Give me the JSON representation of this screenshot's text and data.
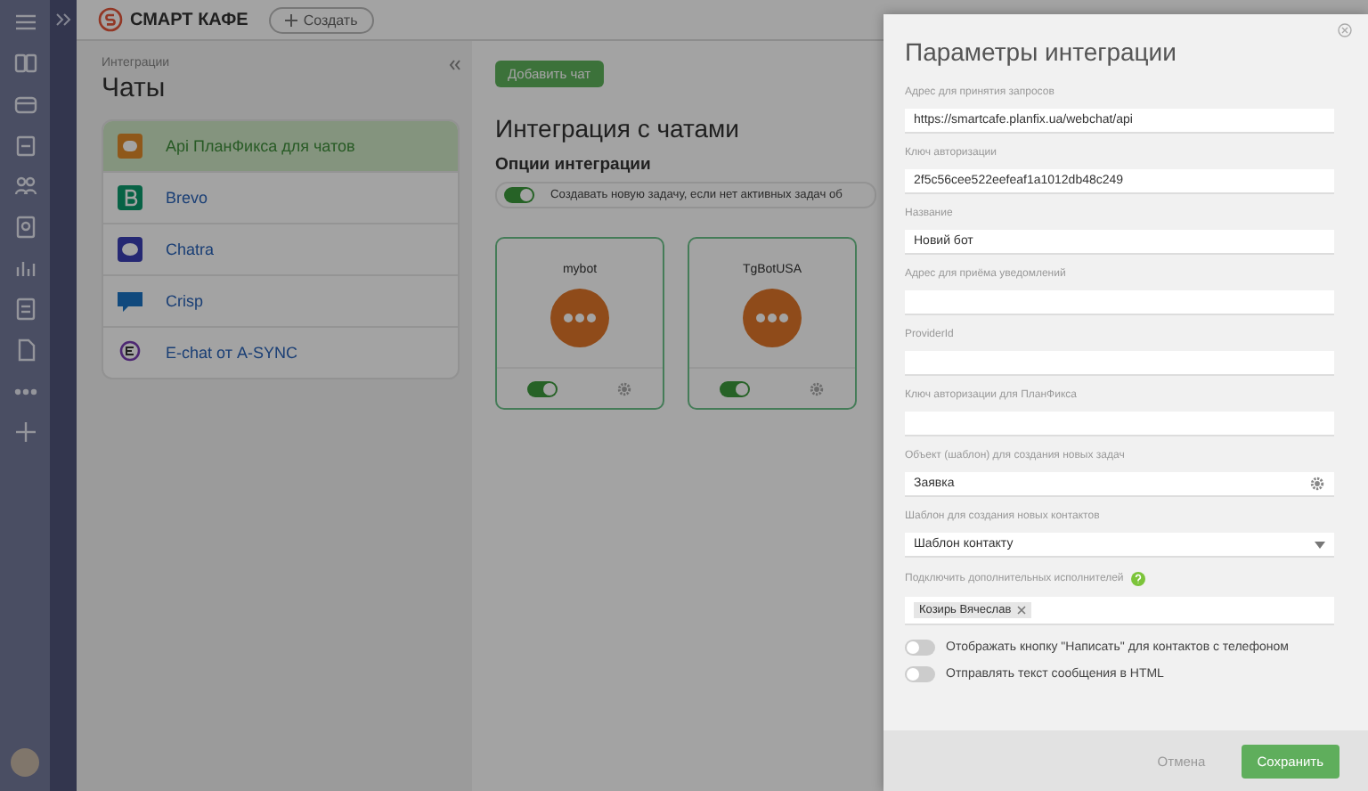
{
  "topbar": {
    "logo": "СМАРТ КАФЕ",
    "create_button": "Создать"
  },
  "left_panel": {
    "breadcrumb": "Интеграции",
    "title": "Чаты",
    "items": [
      {
        "label": "Api ПланФикса для чатов",
        "selected": true,
        "kind": "api"
      },
      {
        "label": "Brevo",
        "selected": false,
        "kind": "brevo"
      },
      {
        "label": "Chatra",
        "selected": false,
        "kind": "chatra"
      },
      {
        "label": "Crisp",
        "selected": false,
        "kind": "crisp"
      },
      {
        "label": "E-chat от A-SYNC",
        "selected": false,
        "kind": "echat"
      }
    ]
  },
  "main": {
    "add_button": "Добавить чат",
    "title": "Интеграция с чатами",
    "options_title": "Опции интеграции",
    "option": {
      "label": "Создавать новую задачу, если нет активных задач об",
      "on": true
    },
    "bots": [
      {
        "name": "mybot",
        "on": true
      },
      {
        "name": "TgBotUSA",
        "on": true
      }
    ]
  },
  "modal": {
    "title": "Параметры интеграции",
    "fields": [
      {
        "label": "Адрес для принятия запросов",
        "value": "https://smartcafe.planfix.ua/webchat/api",
        "kind": "text"
      },
      {
        "label": "Ключ авторизации",
        "value": "2f5c56cee522eefeaf1a1012db48c249",
        "kind": "text"
      },
      {
        "label": "Название",
        "value": "Новий бот",
        "kind": "text"
      },
      {
        "label": "Адрес для приёма уведомлений",
        "kind": "text"
      },
      {
        "label": "ProviderId",
        "kind": "text"
      },
      {
        "label": "Ключ авторизации для ПланФикса",
        "kind": "text"
      },
      {
        "label": "Объект (шаблон) для создания новых задач",
        "value": "Заявка",
        "kind": "gear"
      },
      {
        "label": "Шаблон для создания новых контактов",
        "value": "Шаблон контакту",
        "kind": "select"
      },
      {
        "label": "Подключить дополнительных исполнителей",
        "tags": [
          "Козирь Вячеслав"
        ],
        "kind": "tags"
      }
    ],
    "toggles": [
      {
        "label": "Отображать кнопку \"Написать\" для контактов с телефоном",
        "on": false
      },
      {
        "label": "Отправлять текст сообщения в HTML",
        "on": false
      }
    ],
    "cancel_button": "Отмена",
    "save_button": "Сохранить"
  }
}
